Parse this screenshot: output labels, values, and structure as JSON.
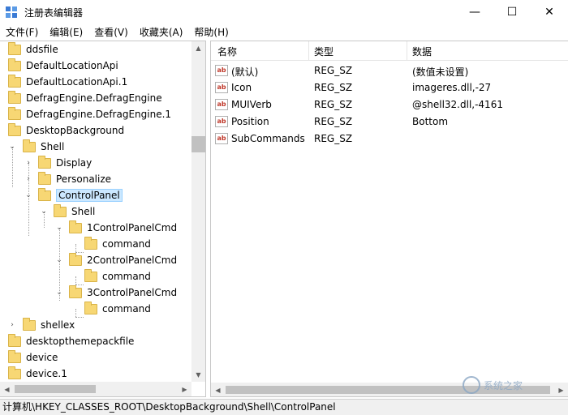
{
  "window": {
    "title": "注册表编辑器",
    "minimize_glyph": "—",
    "maximize_glyph": "☐",
    "close_glyph": "✕"
  },
  "menu": [
    {
      "label": "文件(F)"
    },
    {
      "label": "编辑(E)"
    },
    {
      "label": "查看(V)"
    },
    {
      "label": "收藏夹(A)"
    },
    {
      "label": "帮助(H)"
    }
  ],
  "tree": {
    "items": [
      {
        "label": "ddsfile"
      },
      {
        "label": "DefaultLocationApi"
      },
      {
        "label": "DefaultLocationApi.1"
      },
      {
        "label": "DefragEngine.DefragEngine"
      },
      {
        "label": "DefragEngine.DefragEngine.1"
      },
      {
        "label": "DesktopBackground"
      },
      {
        "label": "Shell",
        "expanded": true
      },
      {
        "label": "Display",
        "expanded": false
      },
      {
        "label": "Personalize",
        "expanded": false
      },
      {
        "label": "ControlPanel",
        "expanded": true,
        "selected": true
      },
      {
        "label": "Shell",
        "expanded": true
      },
      {
        "label": "1ControlPanelCmd",
        "expanded": true
      },
      {
        "label": "command"
      },
      {
        "label": "2ControlPanelCmd",
        "expanded": true
      },
      {
        "label": "command"
      },
      {
        "label": "3ControlPanelCmd",
        "expanded": true
      },
      {
        "label": "command"
      },
      {
        "label": "shellex",
        "expanded": false
      },
      {
        "label": "desktopthemepackfile"
      },
      {
        "label": "device"
      },
      {
        "label": "device.1"
      }
    ]
  },
  "list": {
    "columns": [
      "名称",
      "类型",
      "数据"
    ],
    "rows": [
      {
        "name": "(默认)",
        "type": "REG_SZ",
        "data": "(数值未设置)"
      },
      {
        "name": "Icon",
        "type": "REG_SZ",
        "data": "imageres.dll,-27"
      },
      {
        "name": "MUIVerb",
        "type": "REG_SZ",
        "data": "@shell32.dll,-4161"
      },
      {
        "name": "Position",
        "type": "REG_SZ",
        "data": "Bottom"
      },
      {
        "name": "SubCommands",
        "type": "REG_SZ",
        "data": ""
      }
    ]
  },
  "status": {
    "path": "计算机\\HKEY_CLASSES_ROOT\\DesktopBackground\\Shell\\ControlPanel"
  },
  "watermark": {
    "text": "系统之家"
  },
  "icons": {
    "ab": "ab",
    "arrow_up": "▲",
    "arrow_down": "▼",
    "arrow_left": "◀",
    "arrow_right": "▶",
    "chevron_down": "⌄",
    "chevron_right": "›"
  }
}
